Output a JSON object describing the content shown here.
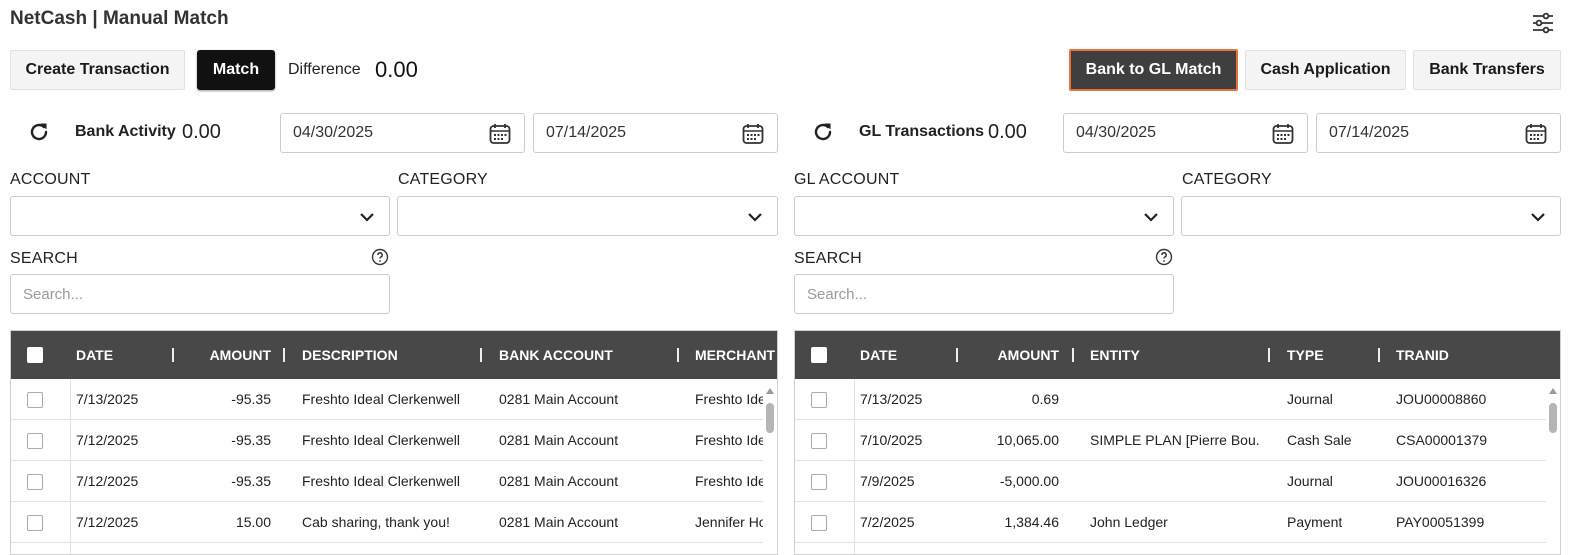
{
  "app": {
    "title": "NetCash | Manual Match"
  },
  "toolbar": {
    "create_transaction": "Create Transaction",
    "match": "Match",
    "difference_label": "Difference",
    "difference_value": "0.00",
    "bank_to_gl": "Bank to GL Match",
    "cash_application": "Cash Application",
    "bank_transfers": "Bank Transfers"
  },
  "colors": {
    "accent_border": "#e8733a",
    "header_bg": "#484848",
    "active_bg": "#3f3f3f"
  },
  "icons": [
    "settings-sliders-icon",
    "refresh-icon",
    "calendar-icon",
    "chevron-down-icon",
    "help-icon"
  ],
  "bank": {
    "label": "Bank Activity",
    "total": "0.00",
    "date_from": "04/30/2025",
    "date_to": "07/14/2025",
    "account_label": "ACCOUNT",
    "account_value": "",
    "category_label": "CATEGORY",
    "category_value": "",
    "search_label": "SEARCH",
    "search_placeholder": "Search...",
    "columns": [
      "DATE",
      "AMOUNT",
      "DESCRIPTION",
      "BANK ACCOUNT",
      "MERCHANT"
    ],
    "rows": [
      {
        "date": "7/13/2025",
        "amount": "-95.35",
        "description": "Freshto Ideal Clerkenwell",
        "bank_account": "0281 Main Account",
        "merchant": "Freshto Ide"
      },
      {
        "date": "7/12/2025",
        "amount": "-95.35",
        "description": "Freshto Ideal Clerkenwell",
        "bank_account": "0281 Main Account",
        "merchant": "Freshto Ide"
      },
      {
        "date": "7/12/2025",
        "amount": "-95.35",
        "description": "Freshto Ideal Clerkenwell",
        "bank_account": "0281 Main Account",
        "merchant": "Freshto Ide"
      },
      {
        "date": "7/12/2025",
        "amount": "15.00",
        "description": "Cab sharing, thank you!",
        "bank_account": "0281 Main Account",
        "merchant": "Jennifer Ho"
      }
    ]
  },
  "gl": {
    "label": "GL Transactions",
    "total": "0.00",
    "date_from": "04/30/2025",
    "date_to": "07/14/2025",
    "account_label": "GL ACCOUNT",
    "account_value": "",
    "category_label": "CATEGORY",
    "category_value": "",
    "search_label": "SEARCH",
    "search_placeholder": "Search...",
    "columns": [
      "DATE",
      "AMOUNT",
      "ENTITY",
      "TYPE",
      "TRANID"
    ],
    "rows": [
      {
        "date": "7/13/2025",
        "amount": "0.69",
        "entity": "",
        "type": "Journal",
        "tranid": "JOU00008860"
      },
      {
        "date": "7/10/2025",
        "amount": "10,065.00",
        "entity": "SIMPLE PLAN [Pierre Bou...",
        "type": "Cash Sale",
        "tranid": "CSA00001379"
      },
      {
        "date": "7/9/2025",
        "amount": "-5,000.00",
        "entity": "",
        "type": "Journal",
        "tranid": "JOU00016326"
      },
      {
        "date": "7/2/2025",
        "amount": "1,384.46",
        "entity": "John Ledger",
        "type": "Payment",
        "tranid": "PAY00051399"
      }
    ]
  }
}
